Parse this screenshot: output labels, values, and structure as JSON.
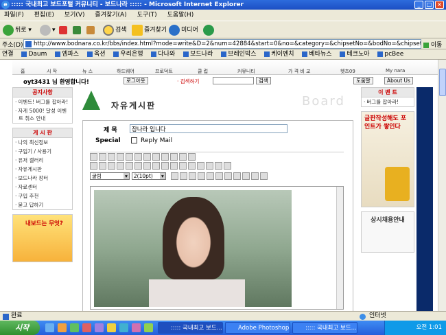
{
  "window": {
    "title": "::::: 국내최고 보드포털 커뮤니티 - 보드나라 ::::: - Microsoft Internet Explorer"
  },
  "menu": [
    "파일(F)",
    "편집(E)",
    "보기(V)",
    "즐겨찾기(A)",
    "도구(T)",
    "도움말(H)"
  ],
  "toolbar": {
    "back": "뒤로",
    "search": "검색",
    "favorites": "즐겨찾기",
    "media": "미디어"
  },
  "address": {
    "label": "주소(D)",
    "url": "http://www.bodnara.co.kr/bbs/index.html?mode=write&D=2&num=42884&start=0&no=&category=&chipsetNo=&bodNo=&chipsetNo=&shopcategory=&chips",
    "go": "이동"
  },
  "links": {
    "label": "연결",
    "items": [
      "Daum",
      "엠파스",
      "옥션",
      "우리은행",
      "다나와",
      "보드나라",
      "브레인박스",
      "케이벤치",
      "베타뉴스",
      "테크노아",
      "pcBee"
    ]
  },
  "nav": [
    "홈",
    "시 작",
    "뉴 스",
    "하드웨어",
    "프로덕트",
    "클 럽",
    "커뮤니티",
    "가 격 비 교",
    "헷츠09",
    "My nara"
  ],
  "greeting": {
    "text": "oyt3431 님 환영합니다!",
    "logout": "로그아웃",
    "search_label": "· 검색하기",
    "search_btn": "검색",
    "help": "도움말",
    "about": "About Us"
  },
  "notice": {
    "title": "공지사항",
    "items": [
      "이벤트! 버그를 잡아라!",
      "자게 5000! 달성 이벤트 취소 안내"
    ]
  },
  "board_menu": {
    "title": "게 시 판",
    "items": [
      "나의 최신정보",
      "구입기 / 사용기",
      "유저 갤러리",
      "자유게시판",
      "보드나라 장터",
      "자료센터",
      "구입 추천",
      "묻고 답하기"
    ]
  },
  "banner_text": "내보드는 무엇?",
  "board": {
    "title": "자유게시판",
    "watermark": "Board",
    "subject_label": "제 목",
    "subject_value": "장나라 입니다",
    "special_label": "Special",
    "reply_mail": "Reply Mail",
    "font_select": "굴림",
    "size_select": "2(10pt)"
  },
  "right": {
    "event_title": "이 벤 트",
    "event_item": "버그를 잡아라!",
    "ad1": "글판작성해도 포인트가 쌓인다",
    "ad2": "상시채용안내"
  },
  "status": {
    "left": "완료",
    "right": "인터넷"
  },
  "taskbar": {
    "start": "시작",
    "tasks": [
      "::::: 국내최고 보드...",
      "Adobe Photoshop",
      "::::: 국내최고 보드..."
    ],
    "clock": "오전 1:01"
  }
}
